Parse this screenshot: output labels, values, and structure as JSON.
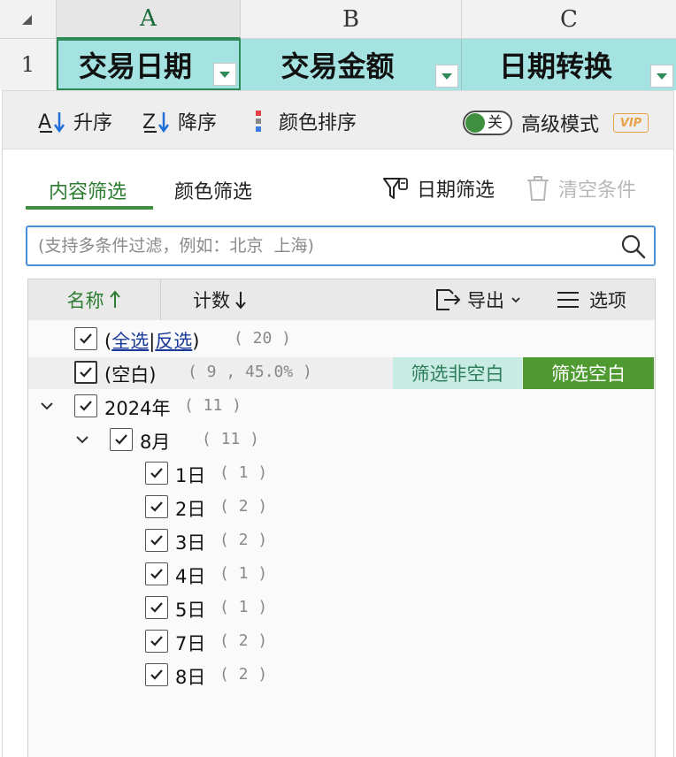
{
  "sheet": {
    "columns": [
      "A",
      "B",
      "C"
    ],
    "row_number": "1",
    "cells": [
      "交易日期",
      "交易金额",
      "日期转换"
    ]
  },
  "sortbar": {
    "asc": "升序",
    "desc": "降序",
    "color": "颜色排序",
    "toggle_text": "关",
    "advanced": "高级模式",
    "vip": "VIP"
  },
  "tabs": {
    "content": "内容筛选",
    "color": "颜色筛选"
  },
  "actions": {
    "date_filter": "日期筛选",
    "clear": "清空条件"
  },
  "search": {
    "placeholder": "(支持多条件过滤，例如：北京  上海)"
  },
  "list_header": {
    "name": "名称",
    "count": "计数",
    "export": "导出",
    "options": "选项"
  },
  "rows": {
    "all": {
      "select_all": "全选",
      "divider": "|",
      "invert": "反选",
      "open": "(",
      "close": ")",
      "count": "( 20 )"
    },
    "blank": {
      "label": "(空白)",
      "count": "( 9 , 45.0% )",
      "btn_nonblank": "筛选非空白",
      "btn_blank": "筛选空白"
    },
    "year": {
      "label": "2024年",
      "count": "( 11 )"
    },
    "month": {
      "label": "8月",
      "count": "( 11 )"
    },
    "days": [
      {
        "label": "1日",
        "count": "( 1 )"
      },
      {
        "label": "2日",
        "count": "( 2 )"
      },
      {
        "label": "3日",
        "count": "( 2 )"
      },
      {
        "label": "4日",
        "count": "( 1 )"
      },
      {
        "label": "5日",
        "count": "( 1 )"
      },
      {
        "label": "7日",
        "count": "( 2 )"
      },
      {
        "label": "8日",
        "count": "( 2 )"
      }
    ]
  },
  "colors": {
    "accent_green": "#3f8f3f",
    "cell_fill": "#a4e3e1",
    "search_border": "#4a90d9",
    "vip_orange": "#e7a24a"
  }
}
